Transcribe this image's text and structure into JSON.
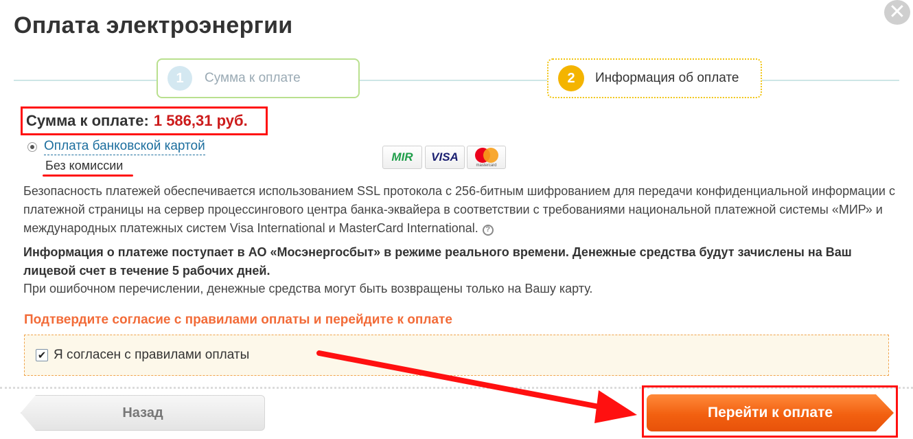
{
  "header": {
    "title": "Оплата электроэнергии",
    "close_glyph": "✕"
  },
  "steps": [
    {
      "number": "1",
      "label": "Сумма к оплате",
      "state": "completed"
    },
    {
      "number": "2",
      "label": "Информация об оплате",
      "state": "active"
    }
  ],
  "summary": {
    "label": "Сумма к оплате:",
    "amount": "1 586,31 руб."
  },
  "payment_method": {
    "label": "Оплата банковской картой",
    "fee": "Без комиссии",
    "selected": true
  },
  "cards": {
    "mir": "MIR",
    "visa": "VISA",
    "mastercard": "mastercard"
  },
  "info": {
    "security": "Безопасность платежей обеспечивается использованием SSL протокола с 256-битным шифрованием для передачи конфиденциальной информации с платежной страницы на сервер процессингового центра банка-эквайера в соответствии с требованиями национальной платежной системы «МИР» и международных платежных систем Visa International и MasterCard International.",
    "help_glyph": "?",
    "notice": "Информация о платеже поступает в АО «Мосэнергосбыт» в режиме реального времени. Денежные средства будут зачислены на Ваш лицевой счет в течение 5 рабочих дней.",
    "refund": "При ошибочном перечислении, денежные средства могут быть возвращены только на Вашу карту."
  },
  "confirm": {
    "title": "Подтвердите согласие с правилами оплаты и перейдите к оплате",
    "checkbox_label": "Я согласен с правилами оплаты",
    "checked": true,
    "check_glyph": "✔"
  },
  "actions": {
    "back_label": "Назад",
    "pay_label": "Перейти к оплате"
  },
  "colors": {
    "accent_orange": "#f26010",
    "highlight_red": "#ff1010",
    "step_active": "#f4b400",
    "link": "#1c6e9e"
  },
  "icons": [
    "close-icon",
    "help-icon",
    "checkmark-icon",
    "radio-dot-icon",
    "arrow-annotation-icon"
  ]
}
